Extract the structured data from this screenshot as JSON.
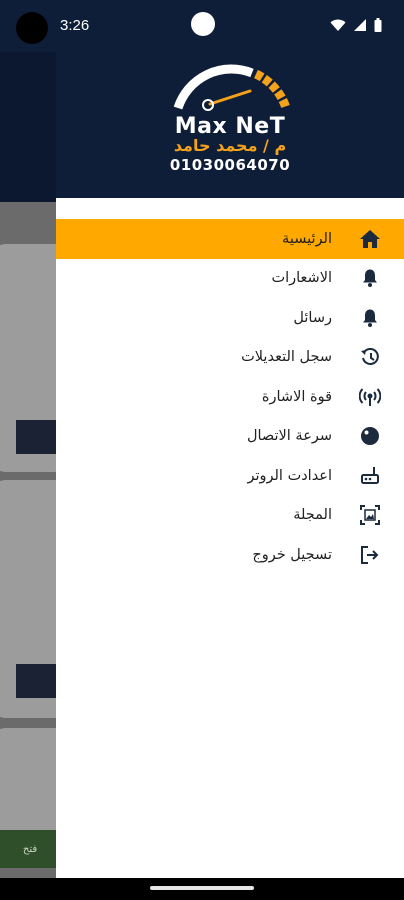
{
  "status_bar": {
    "time": "3:26",
    "icons": [
      "wifi-icon",
      "signal-icon",
      "battery-icon"
    ]
  },
  "drawer": {
    "brand": "Max NeT",
    "owner": "م / محمد حامد",
    "phone": "01030064070",
    "active_color": "#ffa800",
    "header_color": "#0f1e38",
    "items": [
      {
        "label": "الرئيسية",
        "icon": "home-icon",
        "active": true
      },
      {
        "label": "الاشعارات",
        "icon": "bell-icon",
        "active": false
      },
      {
        "label": "رسائل",
        "icon": "bell-icon",
        "active": false
      },
      {
        "label": "سجل التعديلات",
        "icon": "history-icon",
        "active": false
      },
      {
        "label": "قوة الاشارة",
        "icon": "signal-tower-icon",
        "active": false
      },
      {
        "label": "سرعة الاتصال",
        "icon": "speed-ball-icon",
        "active": false
      },
      {
        "label": "اعدادت الروتر",
        "icon": "router-icon",
        "active": false
      },
      {
        "label": "المجلة",
        "icon": "gallery-icon",
        "active": false
      },
      {
        "label": "تسجيل خروج",
        "icon": "logout-icon",
        "active": false
      }
    ]
  },
  "background": {
    "button_label": "فتح"
  }
}
